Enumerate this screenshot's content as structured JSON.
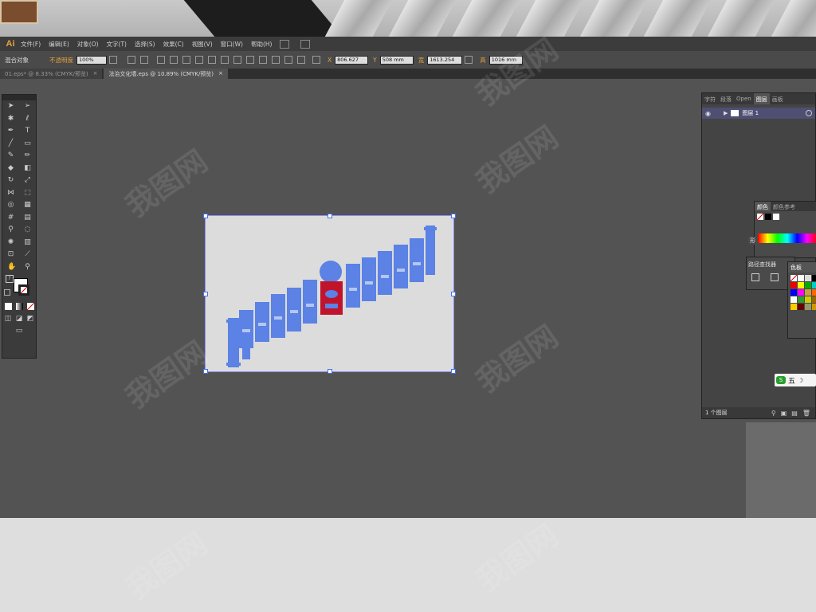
{
  "app": {
    "logo": "Ai"
  },
  "menu": [
    "文件(F)",
    "编辑(E)",
    "对象(O)",
    "文字(T)",
    "选择(S)",
    "效果(C)",
    "视图(V)",
    "窗口(W)",
    "帮助(H)"
  ],
  "control": {
    "object_type": "混合对象",
    "opacity_label": "不透明度",
    "opacity_value": "100%",
    "x_label": "X",
    "x_value": "806.627",
    "y_label": "Y",
    "y_value": "508 mm",
    "w_label": "宽",
    "w_value": "1613.254",
    "h_label": "高",
    "h_value": "1016 mm"
  },
  "tabs": [
    {
      "title": "01.eps* @ 8.33% (CMYK/预览)",
      "close": "×",
      "active": false
    },
    {
      "title": "法治文化墙.eps @ 10.89% (CMYK/预览)",
      "close": "×",
      "active": true
    }
  ],
  "layers_panel": {
    "tabs": [
      "字符",
      "段落",
      "Open",
      "图层",
      "画板"
    ],
    "layer_name": "图层 1",
    "footer": "1 个图层"
  },
  "color_panel": {
    "tabs": [
      "颜色",
      "颜色参考"
    ],
    "shape_label": "形"
  },
  "pathfinder": {
    "title": "路径查找器"
  },
  "swatches": {
    "title": "色板"
  },
  "ime": {
    "label": "五"
  },
  "watermark": "我图网",
  "colors": {
    "accent": "#e8a23a",
    "artwork_blue": "#5b82e4",
    "artwork_red": "#c0142c",
    "workspace": "#535353"
  }
}
